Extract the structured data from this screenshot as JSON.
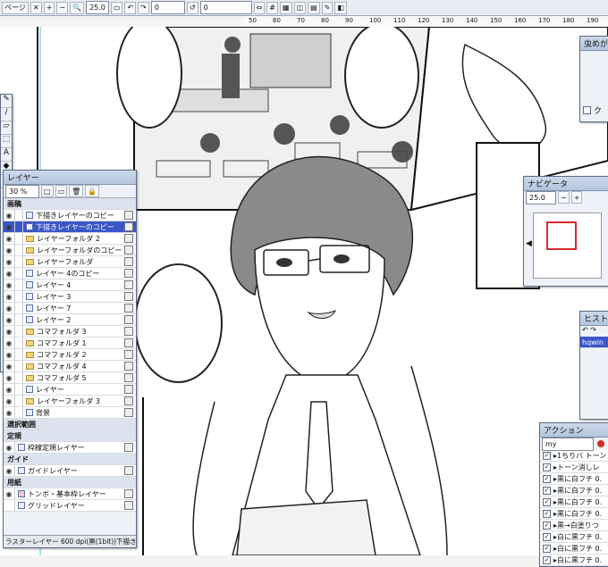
{
  "toolbar": {
    "page_label": "ページ",
    "zoom": "25.0",
    "rotation": "0",
    "angle": "0",
    "icons": [
      "close-icon",
      "rotate-left-icon",
      "rotate-right-icon",
      "fit-icon",
      "grid-icon",
      "ruler-icon",
      "pen-icon",
      "layer-icon"
    ]
  },
  "ruler": {
    "ticks": [
      "50",
      "60",
      "70",
      "80",
      "90",
      "100",
      "110",
      "120",
      "130",
      "140",
      "150",
      "160",
      "170",
      "180",
      "190",
      "200"
    ]
  },
  "layer_panel": {
    "title": "レイヤー",
    "opacity": "30 %",
    "section_manuscript": "画稿",
    "layers": [
      {
        "name": "下描きレイヤーのコピー",
        "type": "layer",
        "selected": false
      },
      {
        "name": "下描きレイヤーのコピー",
        "type": "layer",
        "selected": true
      },
      {
        "name": "レイヤーフォルダ 2",
        "type": "folder",
        "selected": false
      },
      {
        "name": "レイヤーフォルダのコピー",
        "type": "folder",
        "selected": false
      },
      {
        "name": "レイヤーフォルダ",
        "type": "folder",
        "selected": false
      },
      {
        "name": "レイヤー 4のコピー",
        "type": "layer",
        "selected": false
      },
      {
        "name": "レイヤー 4",
        "type": "layer",
        "selected": false
      },
      {
        "name": "レイヤー 3",
        "type": "layer",
        "selected": false
      },
      {
        "name": "レイヤー 7",
        "type": "layer",
        "selected": false
      },
      {
        "name": "レイヤー 2",
        "type": "layer",
        "selected": false
      },
      {
        "name": "コマフォルダ 3",
        "type": "folder",
        "selected": false
      },
      {
        "name": "コマフォルダ 1",
        "type": "folder",
        "selected": false
      },
      {
        "name": "コマフォルダ 2",
        "type": "folder",
        "selected": false
      },
      {
        "name": "コマフォルダ 4",
        "type": "folder",
        "selected": false
      },
      {
        "name": "コマフォルダ 5",
        "type": "folder",
        "selected": false
      },
      {
        "name": "レイヤー",
        "type": "layer",
        "selected": false
      },
      {
        "name": "レイヤーフォルダ 3",
        "type": "folder",
        "selected": false
      },
      {
        "name": "背景",
        "type": "layer",
        "selected": false
      }
    ],
    "section_selection": "選択範囲",
    "section_ruler": "定規",
    "ruler_layer": "枠線定規レイヤー",
    "section_guide": "ガイド",
    "guide_layer": "ガイドレイヤー",
    "section_paper": "用紙",
    "paper_layers": [
      "トンボ・基本枠レイヤー",
      "グリッドレイヤー"
    ],
    "status": "ラスターレイヤー 600 dpi(黒(1bit))下描き..."
  },
  "navigator": {
    "title": "ナビゲータ",
    "zoom": "25.0"
  },
  "top_dialog": {
    "title": "虫めがね",
    "checkbox_label": "ク"
  },
  "history": {
    "title": "ヒストリ",
    "item": "hqwin"
  },
  "action_panel": {
    "title": "アクション",
    "set_name": "my",
    "items": [
      "1ちりバ トーン",
      "トーン消しレ",
      "黒に白フチ 0.",
      "黒に白フチ 0.",
      "黒に白フチ 0.",
      "黒に白フチ 0.",
      "黒→白塗りつ",
      "白に黒フチ 0.",
      "白に黒フチ 0.",
      "白に黒フチ 0."
    ]
  },
  "colors": {
    "selection": "#3b56c8",
    "window_bg": "#eef2f8",
    "title_bar": "#b4c6de",
    "accent_red": "#d42a2a"
  }
}
